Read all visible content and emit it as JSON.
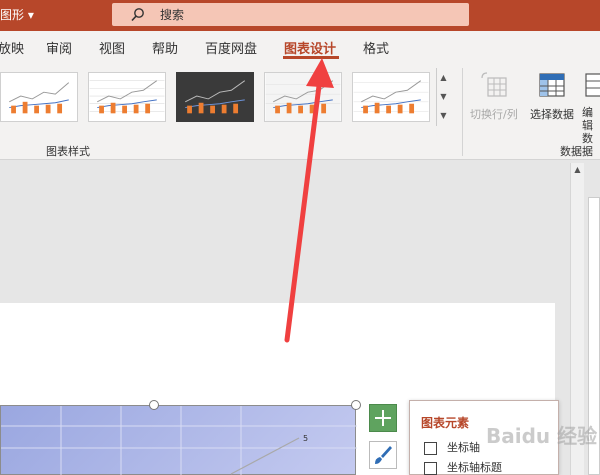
{
  "titlebar": {
    "app_title": "图形 ▾",
    "search_text": "搜索",
    "search_icon": "search-icon"
  },
  "tabs": [
    {
      "label": "放映",
      "active": false
    },
    {
      "label": "审阅",
      "active": false
    },
    {
      "label": "视图",
      "active": false
    },
    {
      "label": "帮助",
      "active": false
    },
    {
      "label": "百度网盘",
      "active": false
    },
    {
      "label": "图表设计",
      "active": true
    },
    {
      "label": "格式",
      "active": false
    }
  ],
  "ribbon": {
    "chart_styles_label": "图表样式",
    "data_group_label": "数据",
    "switch_row_col": "切换行/列",
    "select_data": "选择数据",
    "edit_data": "编辑数据"
  },
  "flyout": {
    "title": "图表元素",
    "items": [
      "坐标轴",
      "坐标轴标题"
    ]
  },
  "chart": {
    "data_label": "5"
  },
  "watermark": "Baidu 经验",
  "colors": {
    "accent": "#b7472a",
    "arrow": "#f04040"
  }
}
